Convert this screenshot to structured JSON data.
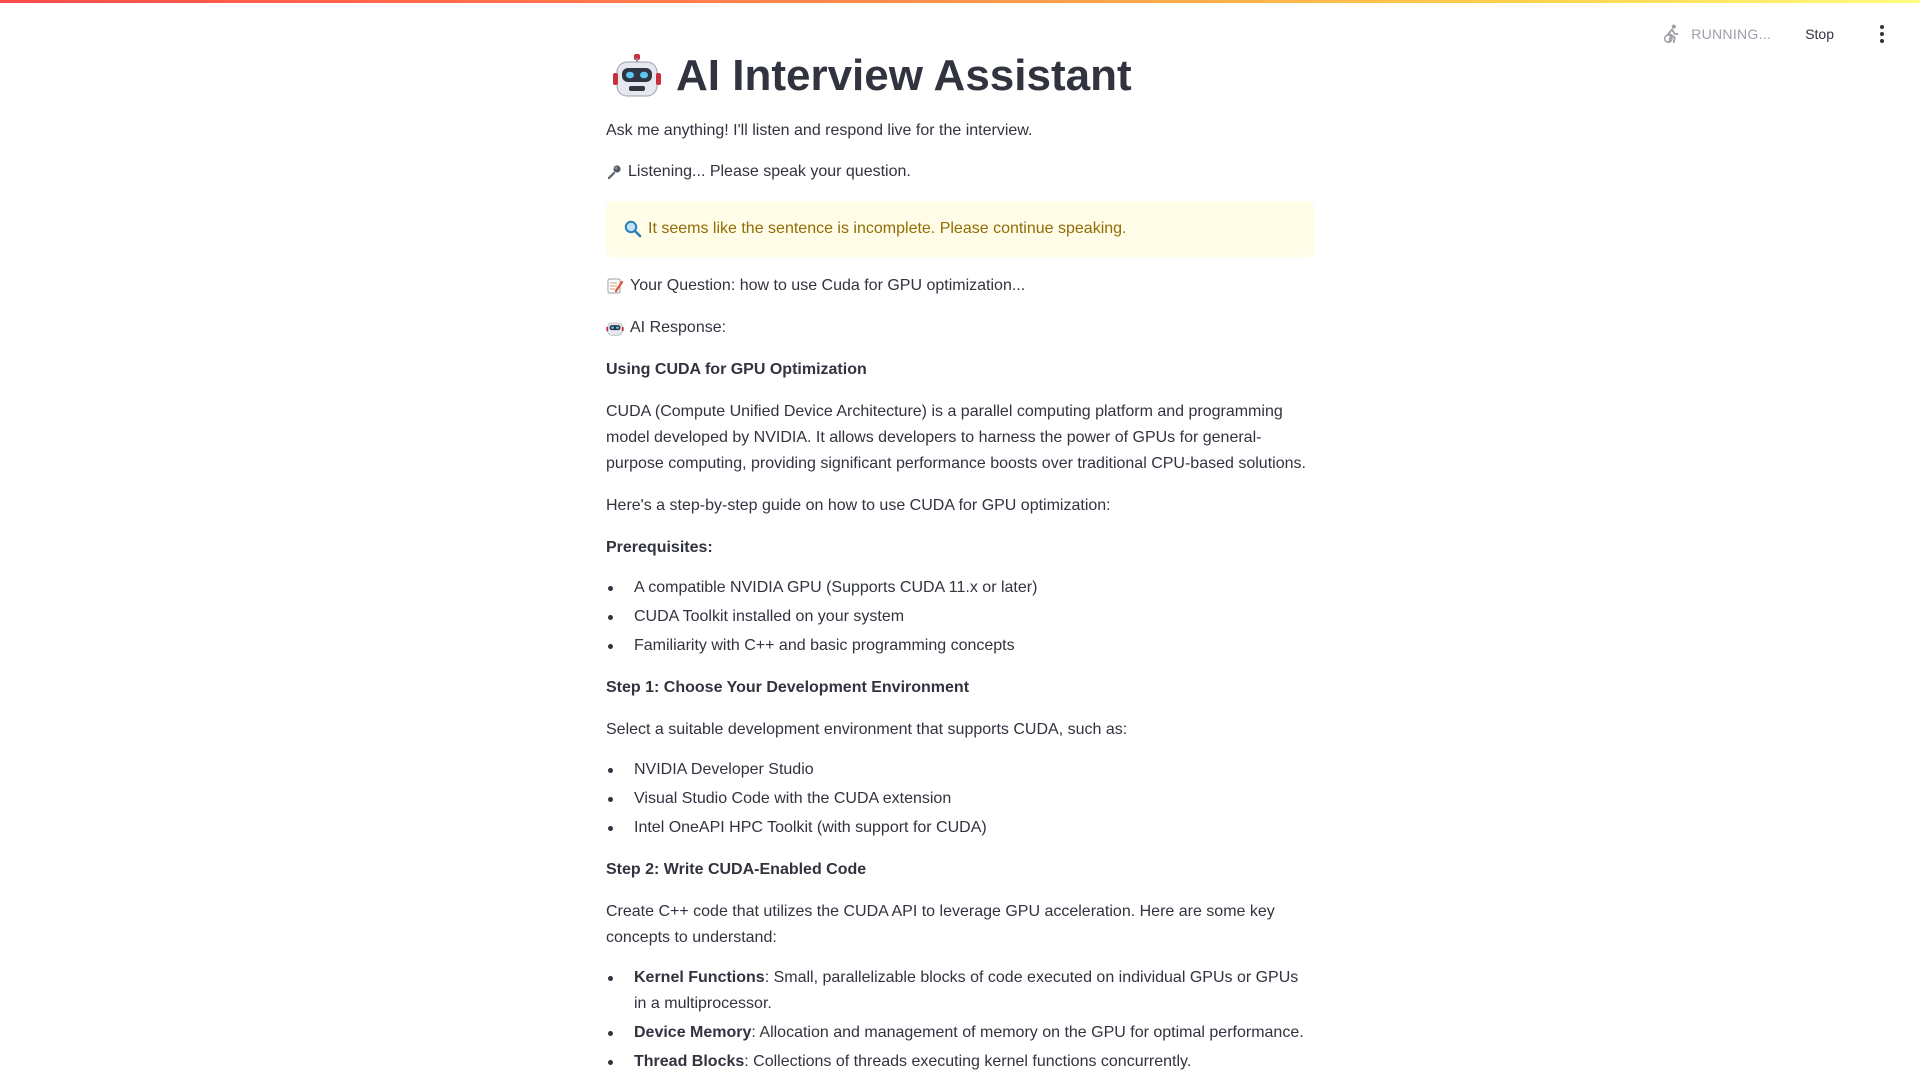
{
  "header": {
    "status_text": "RUNNING...",
    "stop_label": "Stop",
    "status_icon": "running-person-icon",
    "menu_icon": "kebab-menu-icon"
  },
  "app": {
    "title": "AI Interview Assistant",
    "title_icon": "robot-icon",
    "intro": "Ask me anything! I'll listen and respond live for the interview.",
    "listening": "Listening... Please speak your question.",
    "alert": "It seems like the sentence is incomplete. Please continue speaking.",
    "question": "Your Question: how to use Cuda for GPU optimization...",
    "response_label": "AI Response:"
  },
  "response": {
    "heading": "Using CUDA for GPU Optimization",
    "intro": "CUDA (Compute Unified Device Architecture) is a parallel computing platform and programming model developed by NVIDIA. It allows developers to harness the power of GPUs for general-purpose computing, providing significant performance boosts over traditional CPU-based solutions.",
    "guide": "Here's a step-by-step guide on how to use CUDA for GPU optimization:",
    "prereq_heading": "Prerequisites:",
    "prereqs": [
      "A compatible NVIDIA GPU (Supports CUDA 11.x or later)",
      "CUDA Toolkit installed on your system",
      "Familiarity with C++ and basic programming concepts"
    ],
    "step1_heading": "Step 1: Choose Your Development Environment",
    "step1_text": "Select a suitable development environment that supports CUDA, such as:",
    "step1_items": [
      "NVIDIA Developer Studio",
      "Visual Studio Code with the CUDA extension",
      "Intel OneAPI HPC Toolkit (with support for CUDA)"
    ],
    "step2_heading": "Step 2: Write CUDA-Enabled Code",
    "step2_text": "Create C++ code that utilizes the CUDA API to leverage GPU acceleration. Here are some key concepts to understand:",
    "concepts": [
      {
        "term": "Kernel Functions",
        "desc": ": Small, parallelizable blocks of code executed on individual GPUs or GPUs in a multiprocessor."
      },
      {
        "term": "Device Memory",
        "desc": ": Allocation and management of memory on the GPU for optimal performance."
      },
      {
        "term": "Thread Blocks",
        "desc": ": Collections of threads executing kernel functions concurrently."
      }
    ]
  },
  "colors": {
    "alert_bg": "#fffce7",
    "alert_text": "#926c05",
    "text": "#31333f"
  }
}
